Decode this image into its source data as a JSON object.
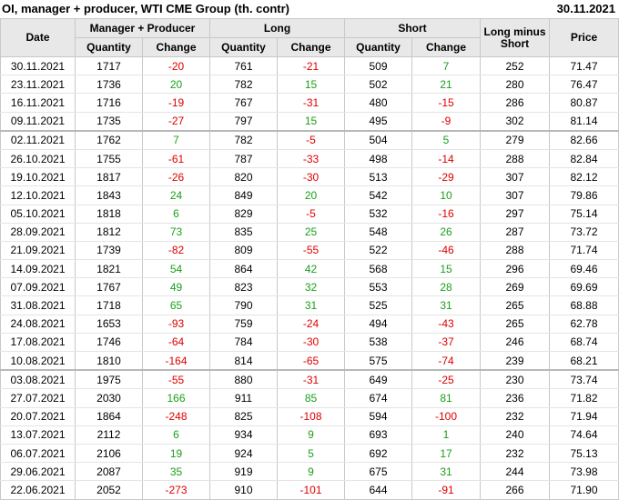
{
  "header": {
    "title": "OI, manager + producer, WTI CME Group (th. contr)",
    "date": "30.11.2021"
  },
  "columns": {
    "date": "Date",
    "mp": "Manager + Producer",
    "long": "Long",
    "short": "Short",
    "lms": "Long minus Short",
    "price": "Price",
    "quantity": "Quantity",
    "change": "Change"
  },
  "rows": [
    [
      "30.11.2021",
      "1717",
      "-20",
      "761",
      "-21",
      "509",
      "7",
      "252",
      "71.47"
    ],
    [
      "23.11.2021",
      "1736",
      "20",
      "782",
      "15",
      "502",
      "21",
      "280",
      "76.47"
    ],
    [
      "16.11.2021",
      "1716",
      "-19",
      "767",
      "-31",
      "480",
      "-15",
      "286",
      "80.87"
    ],
    [
      "09.11.2021",
      "1735",
      "-27",
      "797",
      "15",
      "495",
      "-9",
      "302",
      "81.14"
    ],
    [
      "02.11.2021",
      "1762",
      "7",
      "782",
      "-5",
      "504",
      "5",
      "279",
      "82.66"
    ],
    [
      "26.10.2021",
      "1755",
      "-61",
      "787",
      "-33",
      "498",
      "-14",
      "288",
      "82.84"
    ],
    [
      "19.10.2021",
      "1817",
      "-26",
      "820",
      "-30",
      "513",
      "-29",
      "307",
      "82.12"
    ],
    [
      "12.10.2021",
      "1843",
      "24",
      "849",
      "20",
      "542",
      "10",
      "307",
      "79.86"
    ],
    [
      "05.10.2021",
      "1818",
      "6",
      "829",
      "-5",
      "532",
      "-16",
      "297",
      "75.14"
    ],
    [
      "28.09.2021",
      "1812",
      "73",
      "835",
      "25",
      "548",
      "26",
      "287",
      "73.72"
    ],
    [
      "21.09.2021",
      "1739",
      "-82",
      "809",
      "-55",
      "522",
      "-46",
      "288",
      "71.74"
    ],
    [
      "14.09.2021",
      "1821",
      "54",
      "864",
      "42",
      "568",
      "15",
      "296",
      "69.46"
    ],
    [
      "07.09.2021",
      "1767",
      "49",
      "823",
      "32",
      "553",
      "28",
      "269",
      "69.69"
    ],
    [
      "31.08.2021",
      "1718",
      "65",
      "790",
      "31",
      "525",
      "31",
      "265",
      "68.88"
    ],
    [
      "24.08.2021",
      "1653",
      "-93",
      "759",
      "-24",
      "494",
      "-43",
      "265",
      "62.78"
    ],
    [
      "17.08.2021",
      "1746",
      "-64",
      "784",
      "-30",
      "538",
      "-37",
      "246",
      "68.74"
    ],
    [
      "10.08.2021",
      "1810",
      "-164",
      "814",
      "-65",
      "575",
      "-74",
      "239",
      "68.21"
    ],
    [
      "03.08.2021",
      "1975",
      "-55",
      "880",
      "-31",
      "649",
      "-25",
      "230",
      "73.74"
    ],
    [
      "27.07.2021",
      "2030",
      "166",
      "911",
      "85",
      "674",
      "81",
      "236",
      "71.82"
    ],
    [
      "20.07.2021",
      "1864",
      "-248",
      "825",
      "-108",
      "594",
      "-100",
      "232",
      "71.94"
    ],
    [
      "13.07.2021",
      "2112",
      "6",
      "934",
      "9",
      "693",
      "1",
      "240",
      "74.64"
    ],
    [
      "06.07.2021",
      "2106",
      "19",
      "924",
      "5",
      "692",
      "17",
      "232",
      "75.13"
    ],
    [
      "29.06.2021",
      "2087",
      "35",
      "919",
      "9",
      "675",
      "31",
      "244",
      "73.98"
    ],
    [
      "22.06.2021",
      "2052",
      "-273",
      "910",
      "-101",
      "644",
      "-91",
      "266",
      "71.90"
    ]
  ],
  "group_starts": [
    4,
    17
  ],
  "colors": {
    "negative": "#e00000",
    "positive": "#1aa01a",
    "header_bg": "#e8e8e8"
  }
}
